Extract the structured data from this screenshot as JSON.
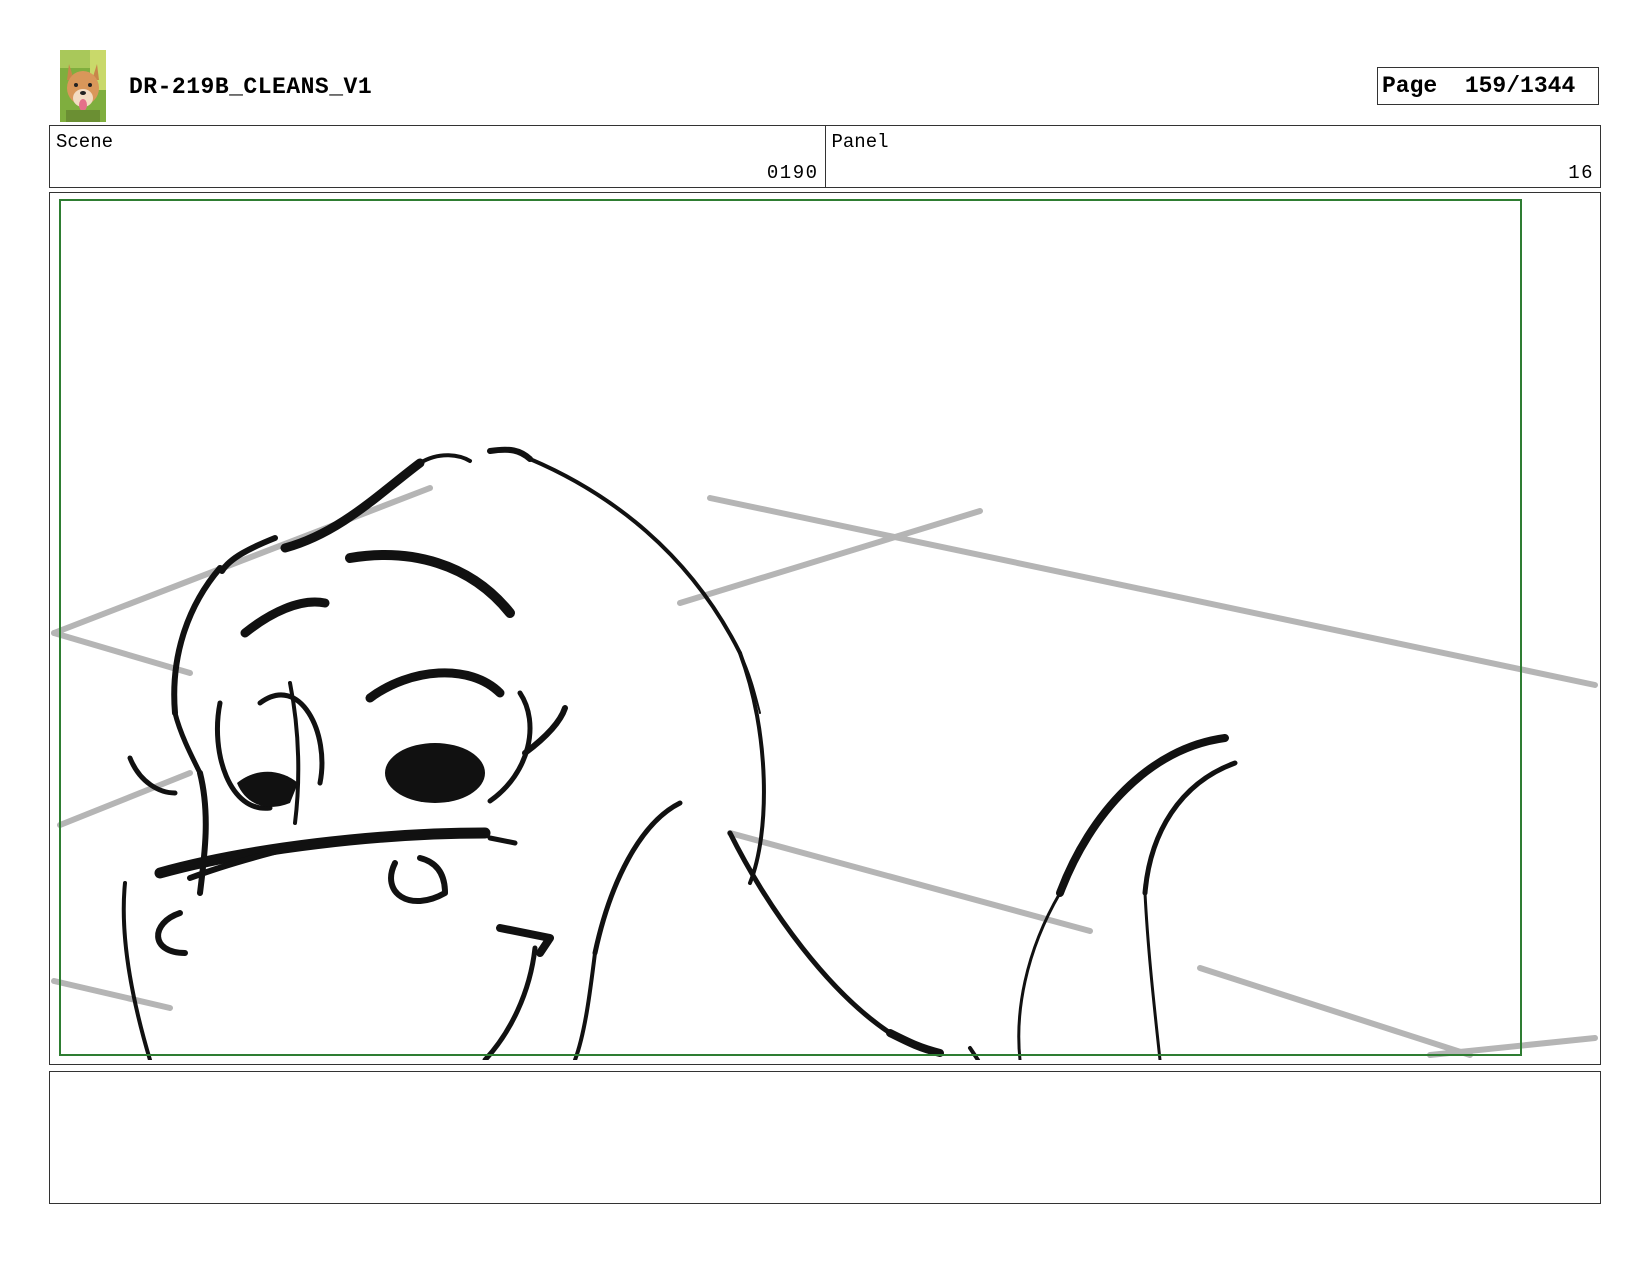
{
  "header": {
    "title": "DR-219B_CLEANS_V1",
    "page_label": "Page",
    "page_number": "159/1344",
    "logo_icon": "dog-photo-icon"
  },
  "info": {
    "scene_label": "Scene",
    "scene_value": "0190",
    "panel_label": "Panel",
    "panel_value": "16"
  },
  "panel": {
    "safe_frame_color": "#2e7d32",
    "line_color": "#111111",
    "guide_color": "#b5b5b5"
  },
  "notes": {
    "text": ""
  }
}
